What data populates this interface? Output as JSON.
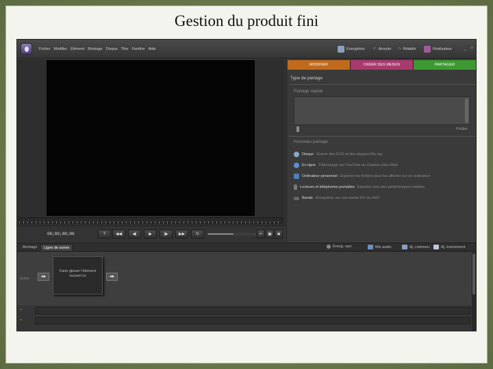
{
  "slide": {
    "title": "Gestion du produit fini"
  },
  "menubar": {
    "items": [
      "Fichier",
      "Modifier",
      "Elément",
      "Montage",
      "Disque",
      "Titre",
      "Fenêtre",
      "Aide"
    ],
    "save_label": "Enregistrer",
    "undo_label": "Annuler",
    "redo_label": "Rétablir",
    "organizer_label": "Réalisateur",
    "minimize": "_",
    "close": "×"
  },
  "monitor": {
    "timecode": "00;00;00;00",
    "volume_level": 0.55
  },
  "panel": {
    "tabs": [
      {
        "label": "MODIFIER",
        "color": "#c26a1c"
      },
      {
        "label": "CRÉER DES MENUS",
        "color": "#a83a6e"
      },
      {
        "label": "PARTAGER",
        "color": "#3d9a32"
      }
    ],
    "title": "Type de partage",
    "quick_share_label": "Partage rapide",
    "publish_label": "Publier",
    "new_share_label": "Nouveau partage",
    "share_options": [
      {
        "name": "Disque",
        "desc": "Graver des DVD et des disques Blu-ray",
        "icon": "disc-icon",
        "color": "#8aa8c8"
      },
      {
        "name": "En ligne",
        "desc": "Télécharger sur YouTube ou d'autres sites Web",
        "icon": "globe-icon",
        "color": "#5a8fd0"
      },
      {
        "name": "Ordinateur personnel",
        "desc": "Exporter les fichiers pour les afficher sur un ordinateur",
        "icon": "computer-icon",
        "color": "#4f7fb8"
      },
      {
        "name": "Lecteurs et téléphones portables",
        "desc": "Exporter vers des périphériques mobiles",
        "icon": "phone-icon",
        "color": "#777777"
      },
      {
        "name": "Bande",
        "desc": "Enregistrer sur une bande DV ou HDV",
        "icon": "tape-icon",
        "color": "#666666"
      }
    ]
  },
  "timeline": {
    "tabs": [
      "Montage",
      "Ligne de scène"
    ],
    "tools": [
      "Enreg. narr.",
      "Mix audio",
      "Aj. commen.",
      "Aj. événement"
    ],
    "drop_zone_text": [
      "Faire glisser l'élément",
      "suivant ici"
    ],
    "scene_label": "Scène",
    "track_labels": [
      "+",
      "≈"
    ]
  },
  "icons": {
    "play": "▶",
    "rewind": "◀◀",
    "forward": "▶▶",
    "step_back": "◀|",
    "step_fwd": "|▶",
    "loop": "↻",
    "arrow": "➡"
  }
}
